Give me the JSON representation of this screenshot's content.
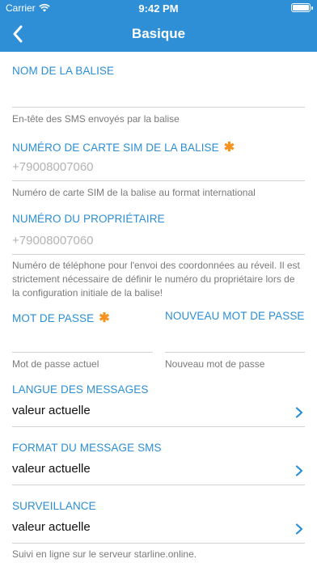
{
  "status_bar": {
    "carrier": "Carrier",
    "time": "9:42 PM"
  },
  "nav": {
    "title": "Basique"
  },
  "fields": {
    "beacon_name": {
      "label": "NOM DE LA BALISE",
      "value": "",
      "hint": "En-tête des SMS envoyés par la balise"
    },
    "sim_number": {
      "label": "NUMÉRO DE CARTE SIM DE LA BALISE",
      "required": "✱",
      "placeholder": "+79008007060",
      "hint": "Numéro de carte SIM de la balise au format international"
    },
    "owner_number": {
      "label": "NUMÉRO DU PROPRIÉTAIRE",
      "placeholder": "+79008007060",
      "hint": "Numéro de téléphone pour l'envoi des coordonnées au réveil. Il est strictement nécessaire de définir le numéro du propriétaire lors de la configuration initiale de la balise!"
    },
    "password": {
      "label": "MOT DE PASSE",
      "required": "✱",
      "hint": "Mot de passe actuel"
    },
    "new_password": {
      "label": "NOUVEAU MOT DE PASSE",
      "hint": "Nouveau mot de passe"
    },
    "message_language": {
      "label": "LANGUE DES MESSAGES",
      "value": "valeur actuelle"
    },
    "sms_format": {
      "label": "FORMAT DU MESSAGE SMS",
      "value": "valeur actuelle"
    },
    "monitoring": {
      "label": "SURVEILLANCE",
      "value": "valeur actuelle",
      "hint": "Suivi en ligne sur le serveur starline.online."
    }
  },
  "colors": {
    "accent": "#2f8fd6",
    "label": "#2b8ed4",
    "required": "#f5931e"
  }
}
